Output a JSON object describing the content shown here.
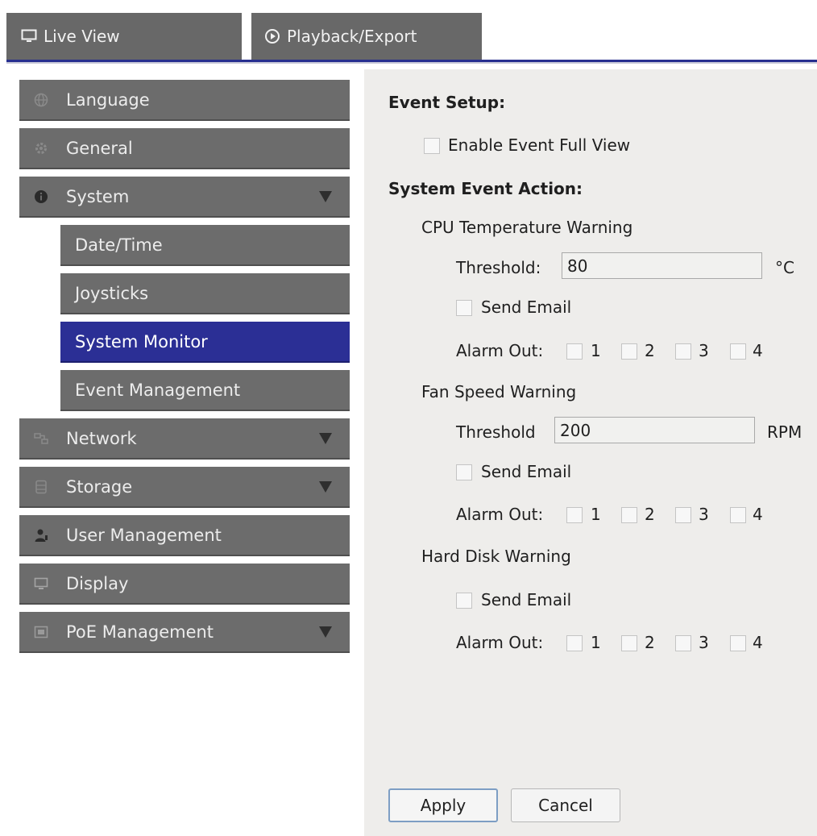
{
  "tabs": [
    {
      "label": "Live View",
      "icon": "monitor-icon"
    },
    {
      "label": "Playback/Export",
      "icon": "play-circle-icon"
    }
  ],
  "sidebar": {
    "items": [
      {
        "label": "Language",
        "icon": "globe-icon"
      },
      {
        "label": "General",
        "icon": "gear-icon"
      },
      {
        "label": "System",
        "icon": "info-icon",
        "expandable": true
      },
      {
        "label": "Date/Time"
      },
      {
        "label": "Joysticks"
      },
      {
        "label": "System Monitor",
        "active": true
      },
      {
        "label": "Event Management"
      },
      {
        "label": "Network",
        "icon": "network-icon",
        "expandable": true
      },
      {
        "label": "Storage",
        "icon": "storage-icon",
        "expandable": true
      },
      {
        "label": "User Management",
        "icon": "user-icon"
      },
      {
        "label": "Display",
        "icon": "monitor-icon"
      },
      {
        "label": "PoE Management",
        "icon": "poe-icon",
        "expandable": true
      }
    ]
  },
  "event_setup": {
    "title": "Event Setup:",
    "enable_full_view": "Enable Event Full View"
  },
  "system_event_action": {
    "title": "System Event Action:",
    "cpu": {
      "title": "CPU Temperature Warning",
      "threshold_label": "Threshold:",
      "threshold_value": "80",
      "unit": "°C",
      "send_email": "Send Email",
      "alarm_out_label": "Alarm Out:",
      "alarm_options": [
        "1",
        "2",
        "3",
        "4"
      ]
    },
    "fan": {
      "title": "Fan Speed Warning",
      "threshold_label": "Threshold",
      "threshold_value": "200",
      "unit": "RPM",
      "send_email": "Send Email",
      "alarm_out_label": "Alarm Out:",
      "alarm_options": [
        "1",
        "2",
        "3",
        "4"
      ]
    },
    "disk": {
      "title": "Hard Disk Warning",
      "send_email": "Send Email",
      "alarm_out_label": "Alarm Out:",
      "alarm_options": [
        "1",
        "2",
        "3",
        "4"
      ]
    }
  },
  "buttons": {
    "apply": "Apply",
    "cancel": "Cancel"
  },
  "colors": {
    "sidebar_bg": "#6c6c6c",
    "active_bg": "#2b2f95",
    "tab_accent": "#272f8f",
    "panel_bg": "#eeedeb"
  }
}
